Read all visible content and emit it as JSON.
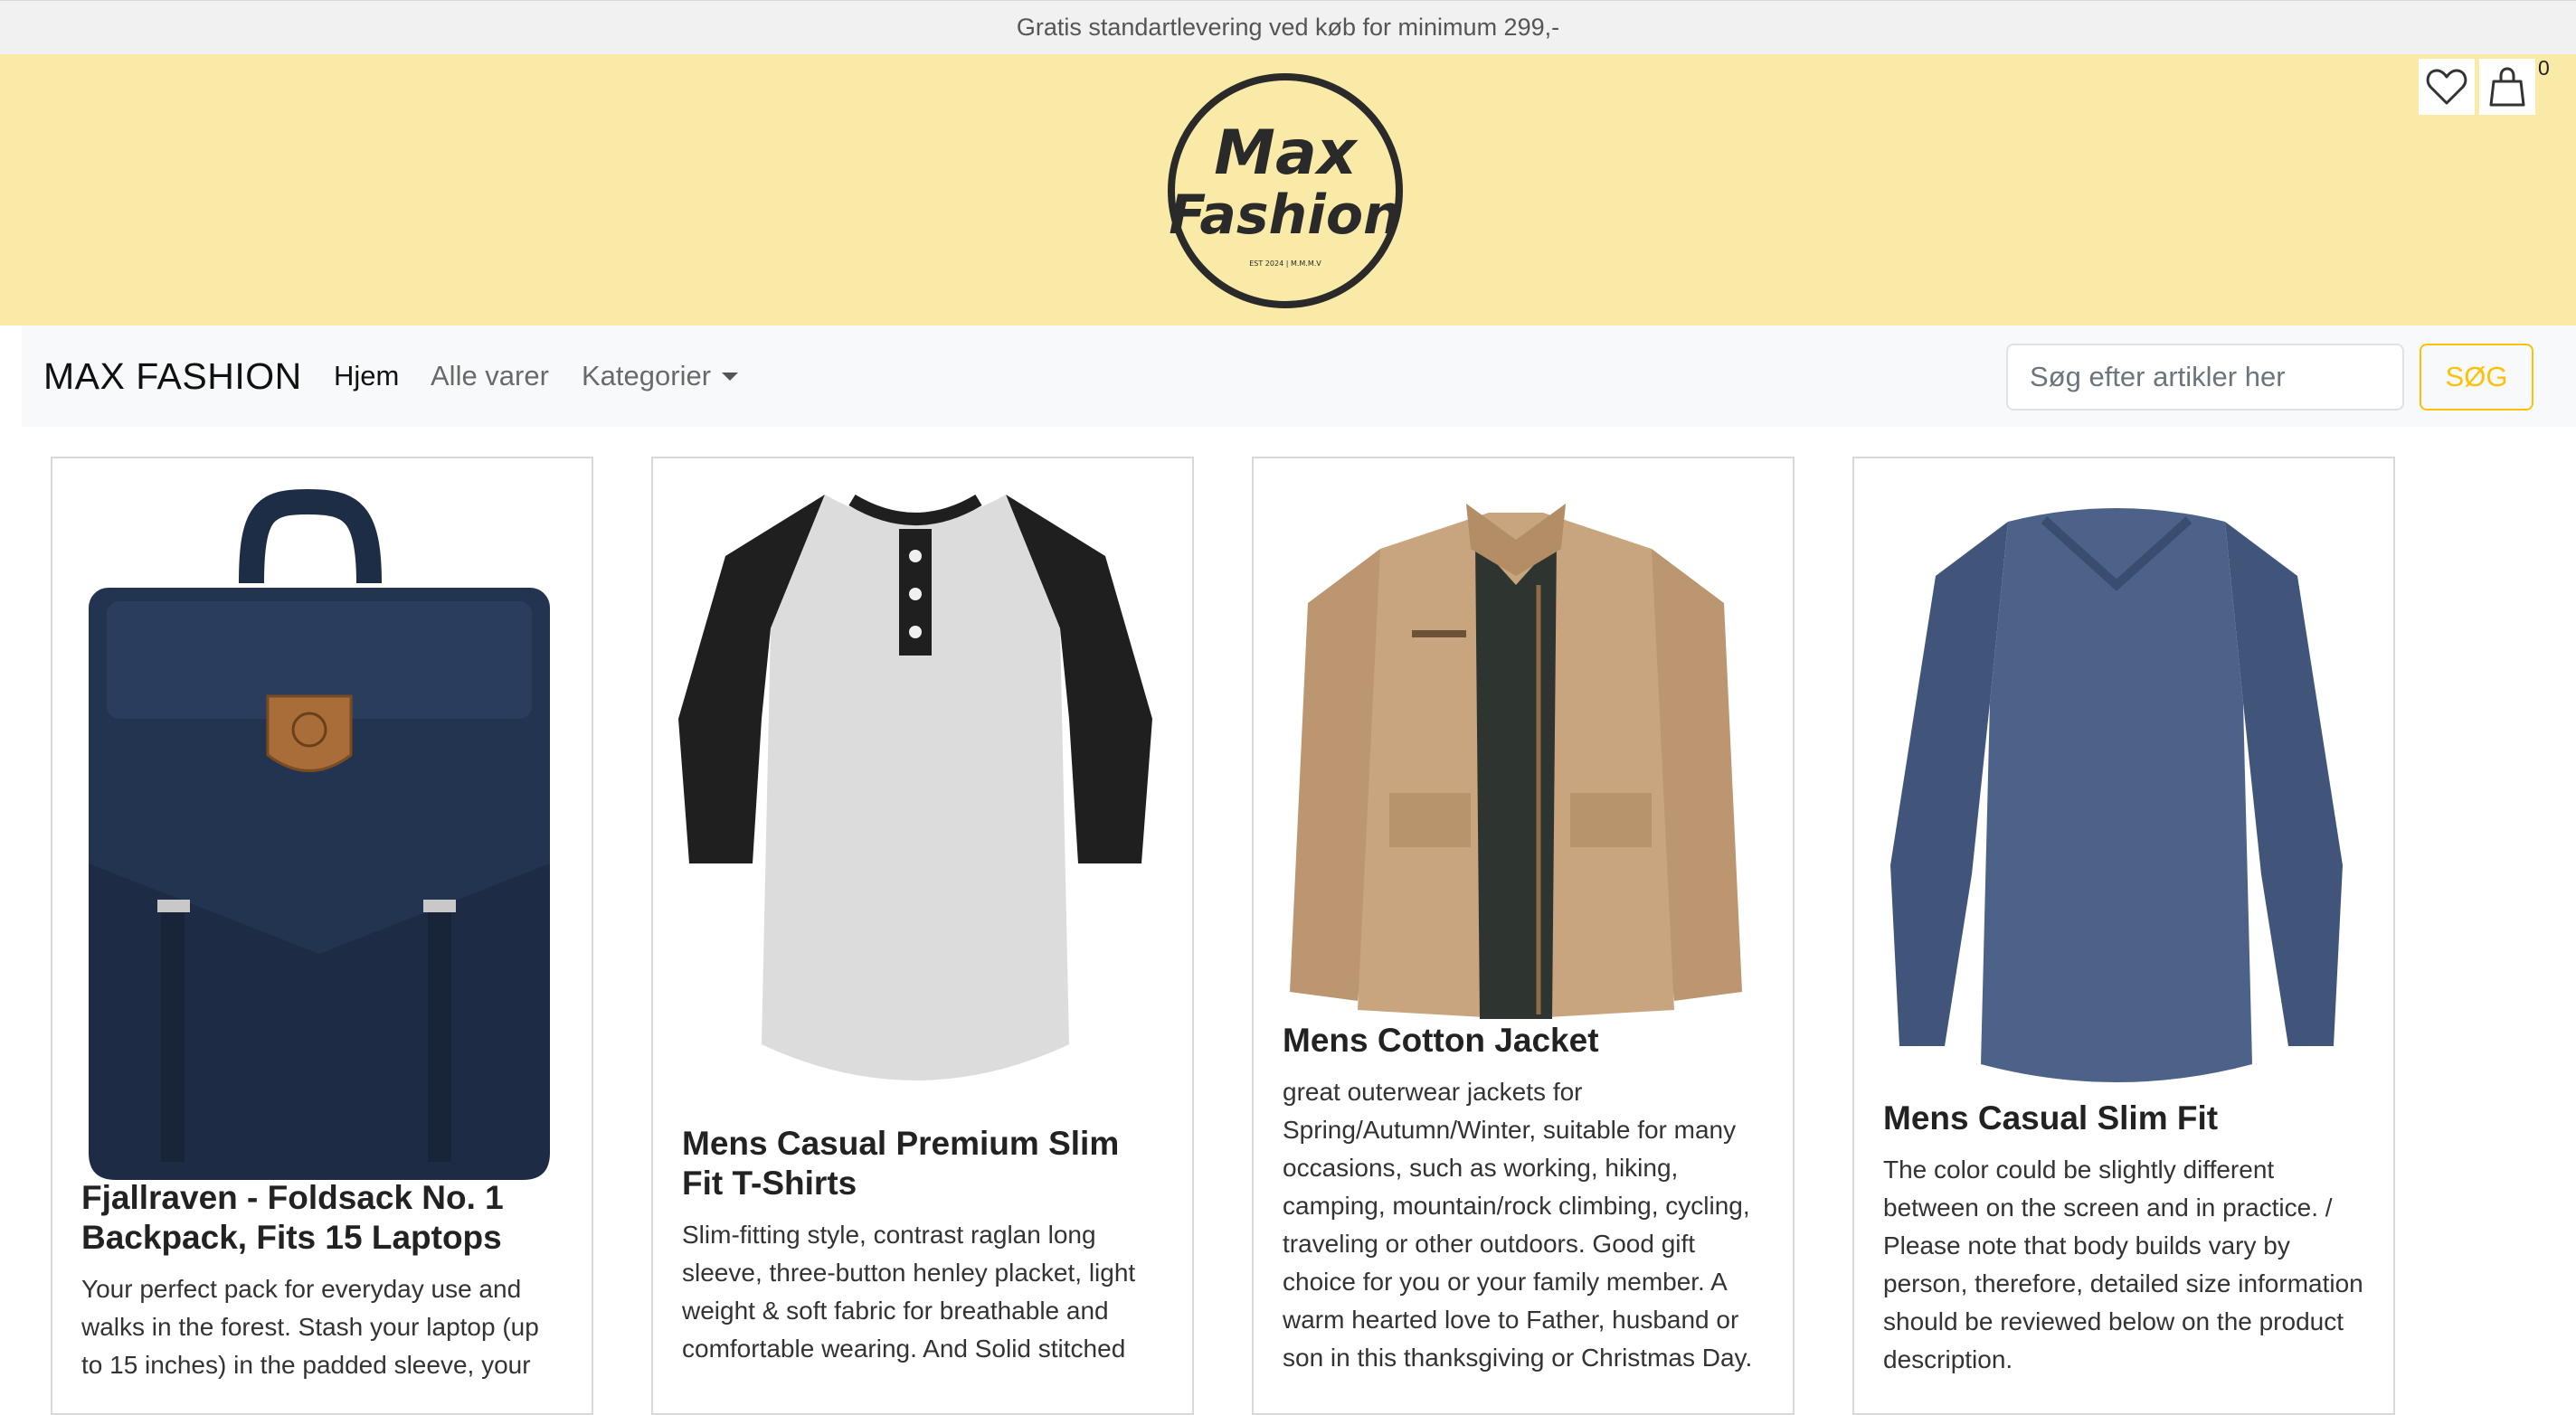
{
  "promo": {
    "text": "Gratis standartlevering ved køb for minimum 299,-"
  },
  "logo": {
    "line1": "Max",
    "line2": "Fashion",
    "tagline": "EST 2024 | M.M.M.V"
  },
  "header": {
    "cart_count": "0",
    "wishlist_icon": "heart-icon",
    "cart_icon": "bag-icon"
  },
  "nav": {
    "brand": "MAX FASHION",
    "items": [
      {
        "label": "Hjem",
        "active": true
      },
      {
        "label": "Alle varer",
        "active": false
      },
      {
        "label": "Kategorier",
        "active": false
      }
    ]
  },
  "search": {
    "placeholder": "Søg efter artikler her",
    "button_label": "SØG"
  },
  "products": [
    {
      "title": "Fjallraven - Foldsack No. 1 Backpack, Fits 15 Laptops",
      "description": "Your perfect pack for everyday use and walks in the forest. Stash your laptop (up to 15 inches) in the padded sleeve, your"
    },
    {
      "title": "Mens Casual Premium Slim Fit T-Shirts",
      "description": "Slim-fitting style, contrast raglan long sleeve, three-button henley placket, light weight & soft fabric for breathable and comfortable wearing. And Solid stitched"
    },
    {
      "title": "Mens Cotton Jacket",
      "description": "great outerwear jackets for Spring/Autumn/Winter, suitable for many occasions, such as working, hiking, camping, mountain/rock climbing, cycling, traveling or other outdoors. Good gift choice for you or your family member. A warm hearted love to Father, husband or son in this thanksgiving or Christmas Day."
    },
    {
      "title": "Mens Casual Slim Fit",
      "description": "The color could be slightly different between on the screen and in practice. / Please note that body builds vary by person, therefore, detailed size information should be reviewed below on the product description."
    }
  ],
  "colors": {
    "banner": "#faeaa8",
    "navbar": "#f8f9fa",
    "accent": "#ffc107",
    "backpack": "#223450",
    "jacket": "#c8a57e",
    "slim_shirt": "#4d6288"
  }
}
